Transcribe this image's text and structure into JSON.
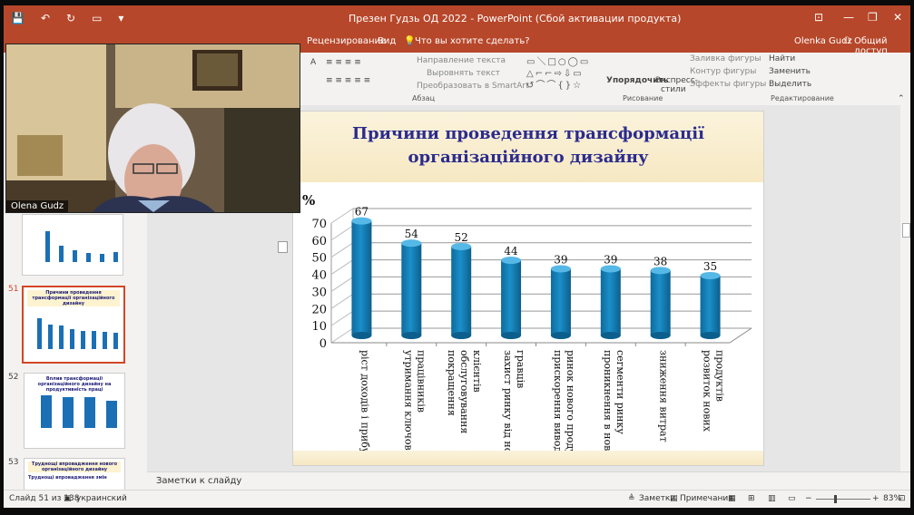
{
  "titlebar": {
    "title": "Презен Гудзь ОД 2022  -  PowerPoint (Сбой активации продукта)",
    "user": "Olenka Gudz",
    "share": "Общий доступ"
  },
  "ribbon_tabs": {
    "review": "Рецензирование",
    "view": "Вид",
    "tell_me": "Что вы хотите сделать?"
  },
  "ribbon": {
    "paragraph": {
      "text_direction": "Направление текста",
      "align_text": "Выровнять текст",
      "convert_smartart": "Преобразовать в SmartArt",
      "label": "Абзац"
    },
    "drawing": {
      "arrange": "Упорядочить",
      "quick_styles_1": "Экспресс-",
      "quick_styles_2": "стили",
      "shape_fill": "Заливка фигуры",
      "shape_outline": "Контур фигуры",
      "shape_effects": "Эффекты фигуры",
      "label": "Рисование"
    },
    "editing": {
      "find": "Найти",
      "replace": "Заменить",
      "select": "Выделить",
      "label": "Редактирование"
    }
  },
  "thumbnails": {
    "num51": "51",
    "num52": "52",
    "num53": "53",
    "t51_title": "Причини проведення трансформації організаційного дизайну",
    "t52_title": "Вплив трансформації організаційного дизайну на продуктивність праці",
    "t53_title": "Труднощі впровадження нового організаційного дизайну",
    "t53_sub": "Труднощі впровадження змін"
  },
  "slide": {
    "title_line1": "Причини проведення трансформації",
    "title_line2": "організаційного дизайну"
  },
  "chart_data": {
    "type": "bar",
    "ylabel": "%",
    "ylim": [
      0,
      70
    ],
    "yticks": [
      "0",
      "10",
      "20",
      "30",
      "40",
      "50",
      "60",
      "70"
    ],
    "categories": [
      [
        "ріст доходів і прибутку"
      ],
      [
        "утримання ключових",
        "працівників"
      ],
      [
        "покращення",
        "обслуговування",
        "клієнтів"
      ],
      [
        "захист ринку від нових",
        "гравців"
      ],
      [
        "прискорення виводу на",
        "ринок нового продукту"
      ],
      [
        "проникнення в нові",
        "сегменти ринку"
      ],
      [
        "зниження витрат"
      ],
      [
        "розвиток нових",
        "продуктів"
      ]
    ],
    "values": [
      67,
      54,
      52,
      44,
      39,
      39,
      38,
      35
    ],
    "data_labels": [
      "67",
      "54",
      "52",
      "44",
      "39",
      "39",
      "38",
      "35"
    ],
    "bar_color": "#1b8fc9",
    "grid": true
  },
  "notes": {
    "label": "Заметки к слайду"
  },
  "video": {
    "name": "Olena Gudz"
  },
  "status": {
    "slide_info": "Слайд 51 из 138",
    "language": "украинский",
    "notes_btn": "Заметки",
    "comments_btn": "Примечания",
    "zoom": "83%"
  },
  "colors": {
    "accent": "#b7472a",
    "title_text": "#2b2b8e"
  }
}
